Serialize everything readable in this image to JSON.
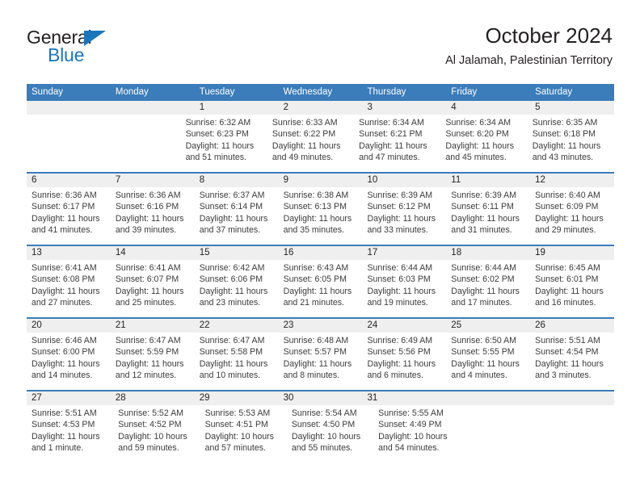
{
  "brand": {
    "name_part1": "General",
    "name_part2": "Blue",
    "accent_color": "#1b75bb"
  },
  "header": {
    "month_title": "October 2024",
    "location": "Al Jalamah, Palestinian Territory"
  },
  "theme": {
    "header_bar_color": "#3b7cba",
    "daynum_band_color": "#efefef",
    "text_color": "#231f20"
  },
  "weekdays": [
    "Sunday",
    "Monday",
    "Tuesday",
    "Wednesday",
    "Thursday",
    "Friday",
    "Saturday"
  ],
  "weeks": [
    {
      "days": [
        {
          "num": "",
          "empty": true
        },
        {
          "num": "",
          "empty": true
        },
        {
          "num": "1",
          "sunrise": "Sunrise: 6:32 AM",
          "sunset": "Sunset: 6:23 PM",
          "daylight": "Daylight: 11 hours and 51 minutes."
        },
        {
          "num": "2",
          "sunrise": "Sunrise: 6:33 AM",
          "sunset": "Sunset: 6:22 PM",
          "daylight": "Daylight: 11 hours and 49 minutes."
        },
        {
          "num": "3",
          "sunrise": "Sunrise: 6:34 AM",
          "sunset": "Sunset: 6:21 PM",
          "daylight": "Daylight: 11 hours and 47 minutes."
        },
        {
          "num": "4",
          "sunrise": "Sunrise: 6:34 AM",
          "sunset": "Sunset: 6:20 PM",
          "daylight": "Daylight: 11 hours and 45 minutes."
        },
        {
          "num": "5",
          "sunrise": "Sunrise: 6:35 AM",
          "sunset": "Sunset: 6:18 PM",
          "daylight": "Daylight: 11 hours and 43 minutes."
        }
      ]
    },
    {
      "days": [
        {
          "num": "6",
          "sunrise": "Sunrise: 6:36 AM",
          "sunset": "Sunset: 6:17 PM",
          "daylight": "Daylight: 11 hours and 41 minutes."
        },
        {
          "num": "7",
          "sunrise": "Sunrise: 6:36 AM",
          "sunset": "Sunset: 6:16 PM",
          "daylight": "Daylight: 11 hours and 39 minutes."
        },
        {
          "num": "8",
          "sunrise": "Sunrise: 6:37 AM",
          "sunset": "Sunset: 6:14 PM",
          "daylight": "Daylight: 11 hours and 37 minutes."
        },
        {
          "num": "9",
          "sunrise": "Sunrise: 6:38 AM",
          "sunset": "Sunset: 6:13 PM",
          "daylight": "Daylight: 11 hours and 35 minutes."
        },
        {
          "num": "10",
          "sunrise": "Sunrise: 6:39 AM",
          "sunset": "Sunset: 6:12 PM",
          "daylight": "Daylight: 11 hours and 33 minutes."
        },
        {
          "num": "11",
          "sunrise": "Sunrise: 6:39 AM",
          "sunset": "Sunset: 6:11 PM",
          "daylight": "Daylight: 11 hours and 31 minutes."
        },
        {
          "num": "12",
          "sunrise": "Sunrise: 6:40 AM",
          "sunset": "Sunset: 6:09 PM",
          "daylight": "Daylight: 11 hours and 29 minutes."
        }
      ]
    },
    {
      "days": [
        {
          "num": "13",
          "sunrise": "Sunrise: 6:41 AM",
          "sunset": "Sunset: 6:08 PM",
          "daylight": "Daylight: 11 hours and 27 minutes."
        },
        {
          "num": "14",
          "sunrise": "Sunrise: 6:41 AM",
          "sunset": "Sunset: 6:07 PM",
          "daylight": "Daylight: 11 hours and 25 minutes."
        },
        {
          "num": "15",
          "sunrise": "Sunrise: 6:42 AM",
          "sunset": "Sunset: 6:06 PM",
          "daylight": "Daylight: 11 hours and 23 minutes."
        },
        {
          "num": "16",
          "sunrise": "Sunrise: 6:43 AM",
          "sunset": "Sunset: 6:05 PM",
          "daylight": "Daylight: 11 hours and 21 minutes."
        },
        {
          "num": "17",
          "sunrise": "Sunrise: 6:44 AM",
          "sunset": "Sunset: 6:03 PM",
          "daylight": "Daylight: 11 hours and 19 minutes."
        },
        {
          "num": "18",
          "sunrise": "Sunrise: 6:44 AM",
          "sunset": "Sunset: 6:02 PM",
          "daylight": "Daylight: 11 hours and 17 minutes."
        },
        {
          "num": "19",
          "sunrise": "Sunrise: 6:45 AM",
          "sunset": "Sunset: 6:01 PM",
          "daylight": "Daylight: 11 hours and 16 minutes."
        }
      ]
    },
    {
      "days": [
        {
          "num": "20",
          "sunrise": "Sunrise: 6:46 AM",
          "sunset": "Sunset: 6:00 PM",
          "daylight": "Daylight: 11 hours and 14 minutes."
        },
        {
          "num": "21",
          "sunrise": "Sunrise: 6:47 AM",
          "sunset": "Sunset: 5:59 PM",
          "daylight": "Daylight: 11 hours and 12 minutes."
        },
        {
          "num": "22",
          "sunrise": "Sunrise: 6:47 AM",
          "sunset": "Sunset: 5:58 PM",
          "daylight": "Daylight: 11 hours and 10 minutes."
        },
        {
          "num": "23",
          "sunrise": "Sunrise: 6:48 AM",
          "sunset": "Sunset: 5:57 PM",
          "daylight": "Daylight: 11 hours and 8 minutes."
        },
        {
          "num": "24",
          "sunrise": "Sunrise: 6:49 AM",
          "sunset": "Sunset: 5:56 PM",
          "daylight": "Daylight: 11 hours and 6 minutes."
        },
        {
          "num": "25",
          "sunrise": "Sunrise: 6:50 AM",
          "sunset": "Sunset: 5:55 PM",
          "daylight": "Daylight: 11 hours and 4 minutes."
        },
        {
          "num": "26",
          "sunrise": "Sunrise: 5:51 AM",
          "sunset": "Sunset: 4:54 PM",
          "daylight": "Daylight: 11 hours and 3 minutes."
        }
      ]
    },
    {
      "days": [
        {
          "num": "27",
          "sunrise": "Sunrise: 5:51 AM",
          "sunset": "Sunset: 4:53 PM",
          "daylight": "Daylight: 11 hours and 1 minute."
        },
        {
          "num": "28",
          "sunrise": "Sunrise: 5:52 AM",
          "sunset": "Sunset: 4:52 PM",
          "daylight": "Daylight: 10 hours and 59 minutes."
        },
        {
          "num": "29",
          "sunrise": "Sunrise: 5:53 AM",
          "sunset": "Sunset: 4:51 PM",
          "daylight": "Daylight: 10 hours and 57 minutes."
        },
        {
          "num": "30",
          "sunrise": "Sunrise: 5:54 AM",
          "sunset": "Sunset: 4:50 PM",
          "daylight": "Daylight: 10 hours and 55 minutes."
        },
        {
          "num": "31",
          "sunrise": "Sunrise: 5:55 AM",
          "sunset": "Sunset: 4:49 PM",
          "daylight": "Daylight: 10 hours and 54 minutes."
        },
        {
          "num": "",
          "empty": true
        },
        {
          "num": "",
          "empty": true
        }
      ]
    }
  ]
}
